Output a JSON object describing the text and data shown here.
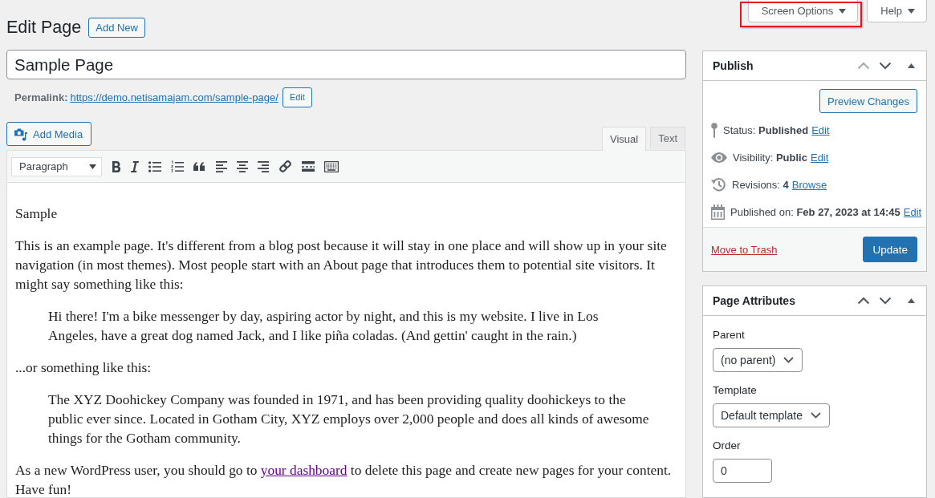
{
  "header_buttons": [
    {
      "label": "Screen Options",
      "highlighted": true
    },
    {
      "label": "Help",
      "highlighted": false
    }
  ],
  "heading": {
    "title": "Edit Page",
    "add_new": "Add New"
  },
  "title_field": {
    "value": "Sample Page"
  },
  "permalink": {
    "label": "Permalink:",
    "url": "https://demo.netisamajam.com/sample-page/",
    "edit": "Edit"
  },
  "editor": {
    "add_media": "Add Media",
    "tabs": [
      {
        "label": "Visual",
        "selected": true
      },
      {
        "label": "Text",
        "selected": false
      }
    ],
    "format": "Paragraph",
    "content": [
      {
        "kind": "paragraph",
        "text": "Sample"
      },
      {
        "kind": "paragraph",
        "text": "This is an example page. It's different from a blog post because it will stay in one place and will show up in your site navigation (in most themes). Most people start with an About page that introduces them to potential site visitors. It might say something like this:"
      },
      {
        "kind": "quote",
        "text": "Hi there! I'm a bike messenger by day, aspiring actor by night, and this is my website. I live in Los Angeles, have a great dog named Jack, and I like piña coladas. (And gettin' caught in the rain.)"
      },
      {
        "kind": "paragraph",
        "text": "...or something like this:"
      },
      {
        "kind": "quote",
        "text": "The XYZ Doohickey Company was founded in 1971, and has been providing quality doohickeys to the public ever since. Located in Gotham City, XYZ employs over 2,000 people and does all kinds of awesome things for the Gotham community."
      },
      {
        "kind": "paragraph",
        "text": "As a new WordPress user, you should go to ",
        "link": "your dashboard",
        "text_after": " to delete this page and create new pages for your content. Have fun!"
      }
    ]
  },
  "publish": {
    "title": "Publish",
    "move_up_disabled": true,
    "preview": "Preview Changes",
    "rows": [
      {
        "kind": "status",
        "label": "Status:",
        "value": "Published",
        "action": "Edit"
      },
      {
        "kind": "visibility",
        "label": "Visibility:",
        "value": "Public",
        "action": "Edit"
      },
      {
        "kind": "revisions",
        "label": "Revisions:",
        "value": "4",
        "action": "Browse"
      },
      {
        "kind": "date",
        "label": "Published on:",
        "value": "Feb 27, 2023 at 14:45",
        "action": "Edit"
      }
    ],
    "trash": "Move to Trash",
    "update": "Update"
  },
  "page_attributes": {
    "title": "Page Attributes",
    "move_up_disabled": false,
    "fields": [
      {
        "kind": "select",
        "label": "Parent",
        "value": "(no parent)"
      },
      {
        "kind": "select",
        "label": "Template",
        "value": "Default template"
      },
      {
        "kind": "input",
        "label": "Order",
        "value": "0"
      }
    ]
  }
}
